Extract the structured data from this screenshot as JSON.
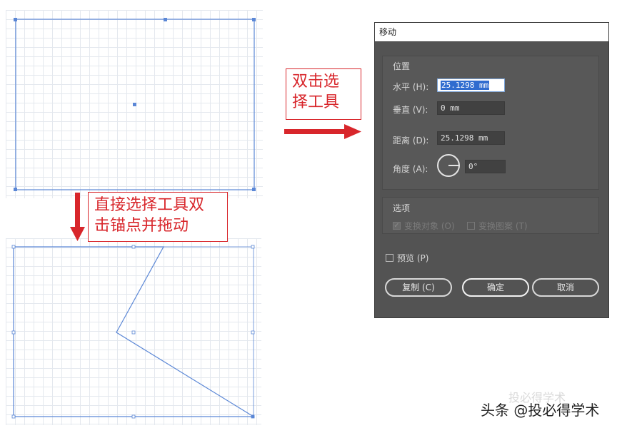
{
  "annotations": {
    "top_label": [
      "双击选",
      "择工具"
    ],
    "bottom_label": [
      "直接选择工具双",
      "击锚点并拖动"
    ]
  },
  "dialog": {
    "title": "移动",
    "position_section": "位置",
    "horizontal": {
      "label": "水平 (H):",
      "value": "25.1298 mm"
    },
    "vertical": {
      "label": "垂直 (V):",
      "value": "0 mm"
    },
    "distance": {
      "label": "距离 (D):",
      "value": "25.1298 mm"
    },
    "angle": {
      "label": "角度 (A):",
      "value": "0°"
    },
    "options_section": "选项",
    "transform_objects": "变换对象 (O)",
    "transform_patterns": "变换图案 (T)",
    "preview": "预览 (P)",
    "buttons": {
      "copy": "复制 (C)",
      "ok": "确定",
      "cancel": "取消"
    }
  },
  "watermark": "头条 @投必得学术",
  "watermark_faint": "投必得学术",
  "colors": {
    "accent_red": "#d8262b",
    "shape_blue": "#5b87d6",
    "dialog_bg": "#535353"
  }
}
